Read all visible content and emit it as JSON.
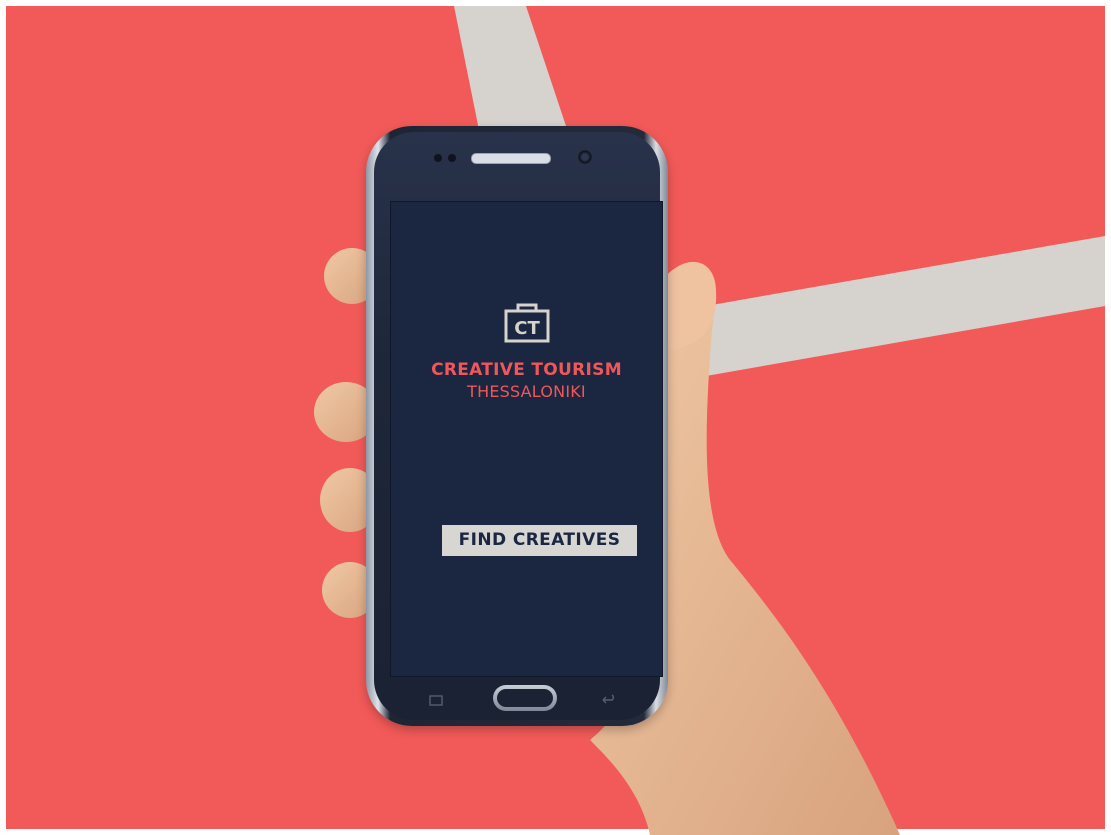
{
  "colors": {
    "background": "#f25a59",
    "stripe": "#d6d2cd",
    "screen": "#1b2641",
    "brand": "#f0575a",
    "button_bg": "#d8d6d3",
    "button_text": "#1b2641"
  },
  "app": {
    "logo_text": "CT",
    "logo_icon": "briefcase-icon",
    "title": "CREATIVE TOURISM",
    "subtitle": "THESSALONIKI",
    "cta_label": "FIND CREATIVES"
  },
  "device": {
    "home_button_icon": "home-button-icon",
    "recent_apps_icon": "recent-apps-icon",
    "back_icon": "back-arrow-icon"
  }
}
